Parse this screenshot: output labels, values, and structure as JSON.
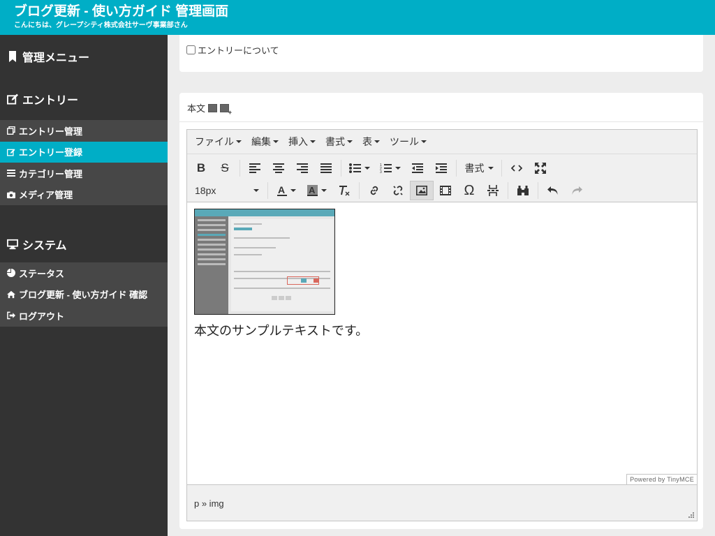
{
  "header": {
    "title": "ブログ更新 - 使い方ガイド 管理画面",
    "subtitle": "こんにちは、グレープシティ株式会社サーヴ事業部さん"
  },
  "sidebar": {
    "sections": [
      {
        "title": "管理メニュー",
        "icon": "bookmark-icon",
        "items": []
      },
      {
        "title": "エントリー",
        "icon": "edit-icon",
        "items": [
          {
            "label": "エントリー管理",
            "icon": "copy-icon",
            "active": false
          },
          {
            "label": "エントリー登録",
            "icon": "edit-icon",
            "active": true
          },
          {
            "label": "カテゴリー管理",
            "icon": "list-icon",
            "active": false
          },
          {
            "label": "メディア管理",
            "icon": "camera-icon",
            "active": false
          }
        ]
      },
      {
        "title": "システム",
        "icon": "monitor-icon",
        "items": [
          {
            "label": "ステータス",
            "icon": "pie-chart-icon"
          },
          {
            "label": "ブログ更新 - 使い方ガイド 確認",
            "icon": "home-icon"
          },
          {
            "label": "ログアウト",
            "icon": "sign-out-icon"
          }
        ]
      }
    ]
  },
  "entry_about": {
    "label": "エントリーについて",
    "checked": false
  },
  "body_field": {
    "label": "本文"
  },
  "editor": {
    "menus": [
      "ファイル",
      "編集",
      "挿入",
      "書式",
      "表",
      "ツール"
    ],
    "format_label": "書式",
    "font_size": "18px",
    "content_text": "本文のサンプルテキストです。",
    "path": "p » img",
    "powered_by": "Powered by TinyMCE"
  },
  "colors": {
    "accent": "#00aec6",
    "sidebar_bg": "#333333",
    "sidebar_list_bg": "#474747"
  }
}
